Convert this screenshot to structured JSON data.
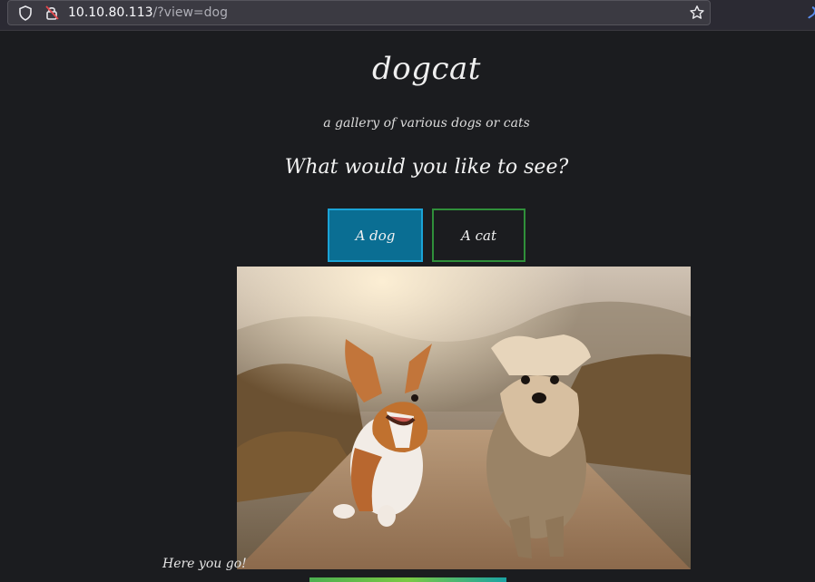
{
  "browser": {
    "url_host": "10.10.80.113",
    "url_path": "/?view=dog",
    "icons": [
      "shield-icon",
      "lock-warning-icon",
      "star-icon"
    ]
  },
  "page": {
    "title": "dogcat",
    "subtitle": "a gallery of various dogs or cats",
    "prompt": "What would you like to see?",
    "buttons": {
      "dog": "A dog",
      "cat": "A cat"
    },
    "caption": "Here you go!"
  },
  "colors": {
    "background": "#1b1c1f",
    "dog_button": "#0a6e93",
    "cat_button_border": "#2f8f3a"
  }
}
